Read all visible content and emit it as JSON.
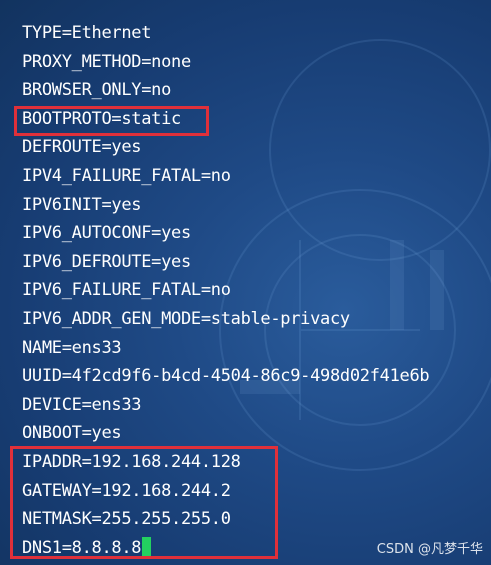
{
  "terminal": {
    "lines": [
      "TYPE=Ethernet",
      "PROXY_METHOD=none",
      "BROWSER_ONLY=no",
      "BOOTPROTO=static",
      "DEFROUTE=yes",
      "IPV4_FAILURE_FATAL=no",
      "IPV6INIT=yes",
      "IPV6_AUTOCONF=yes",
      "IPV6_DEFROUTE=yes",
      "IPV6_FAILURE_FATAL=no",
      "IPV6_ADDR_GEN_MODE=stable-privacy",
      "NAME=ens33",
      "UUID=4f2cd9f6-b4cd-4504-86c9-498d02f41e6b",
      "DEVICE=ens33",
      "ONBOOT=yes",
      "IPADDR=192.168.244.128",
      "GATEWAY=192.168.244.2",
      "NETMASK=255.255.255.0",
      "DNS1=8.8.8.8"
    ]
  },
  "watermark": "CSDN @凡梦千华",
  "colors": {
    "text": "#ffffff",
    "highlight_border": "#e0303a",
    "cursor": "#23d160"
  }
}
